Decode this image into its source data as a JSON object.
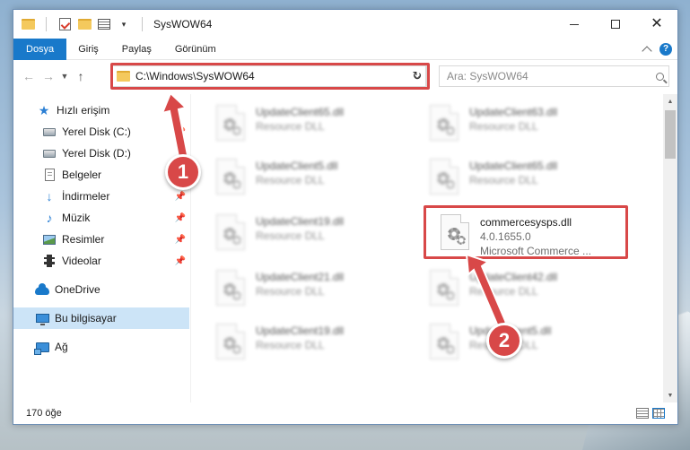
{
  "window": {
    "title": "SysWOW64"
  },
  "ribbon": {
    "tabs": [
      "Dosya",
      "Giriş",
      "Paylaş",
      "Görünüm"
    ],
    "help": "?"
  },
  "nav": {
    "address_path": "C:\\Windows\\SysWOW64",
    "search_placeholder": "Ara: SysWOW64"
  },
  "sidebar": {
    "items": [
      {
        "label": "Hızlı erişim",
        "icon": "star-icon",
        "pinned": false
      },
      {
        "label": "Yerel Disk (C:)",
        "icon": "drive-icon",
        "pinned": true
      },
      {
        "label": "Yerel Disk (D:)",
        "icon": "drive-icon",
        "pinned": false
      },
      {
        "label": "Belgeler",
        "icon": "documents-icon",
        "pinned": false
      },
      {
        "label": "İndirmeler",
        "icon": "downloads-icon",
        "pinned": true
      },
      {
        "label": "Müzik",
        "icon": "music-icon",
        "pinned": true
      },
      {
        "label": "Resimler",
        "icon": "pictures-icon",
        "pinned": true
      },
      {
        "label": "Videolar",
        "icon": "videos-icon",
        "pinned": true
      },
      {
        "label": "OneDrive",
        "icon": "onedrive-icon",
        "pinned": false
      },
      {
        "label": "Bu bilgisayar",
        "icon": "this-pc-icon",
        "pinned": false
      },
      {
        "label": "Ağ",
        "icon": "network-icon",
        "pinned": false
      }
    ]
  },
  "files": [
    {
      "name": "UpdateClient65.dll",
      "sub": "Resource DLL"
    },
    {
      "name": "UpdateClient63.dll",
      "sub": "Resource DLL"
    },
    {
      "name": "UpdateClient5.dll",
      "sub": "Resource DLL"
    },
    {
      "name": "UpdateClient65.dll",
      "sub": "Resource DLL"
    },
    {
      "name": "UpdateClient19.dll",
      "sub": "Resource DLL"
    },
    {
      "name": "commercesysps.dll",
      "version": "4.0.1655.0",
      "sub": "Microsoft Commerce ..."
    },
    {
      "name": "UpdateClient21.dll",
      "sub": "Resource DLL"
    },
    {
      "name": "UpdateClient42.dll",
      "sub": "Resource DLL"
    },
    {
      "name": "UpdateClient19.dll",
      "sub": "Resource DLL"
    },
    {
      "name": "UpdateClient5.dll",
      "sub": "Resource DLL"
    }
  ],
  "status": {
    "count": "170 öğe"
  },
  "annotations": {
    "step1": "1",
    "step2": "2",
    "color": "#d84848"
  },
  "colors": {
    "accent": "#1979ca",
    "selected_bg": "#cce4f7"
  }
}
